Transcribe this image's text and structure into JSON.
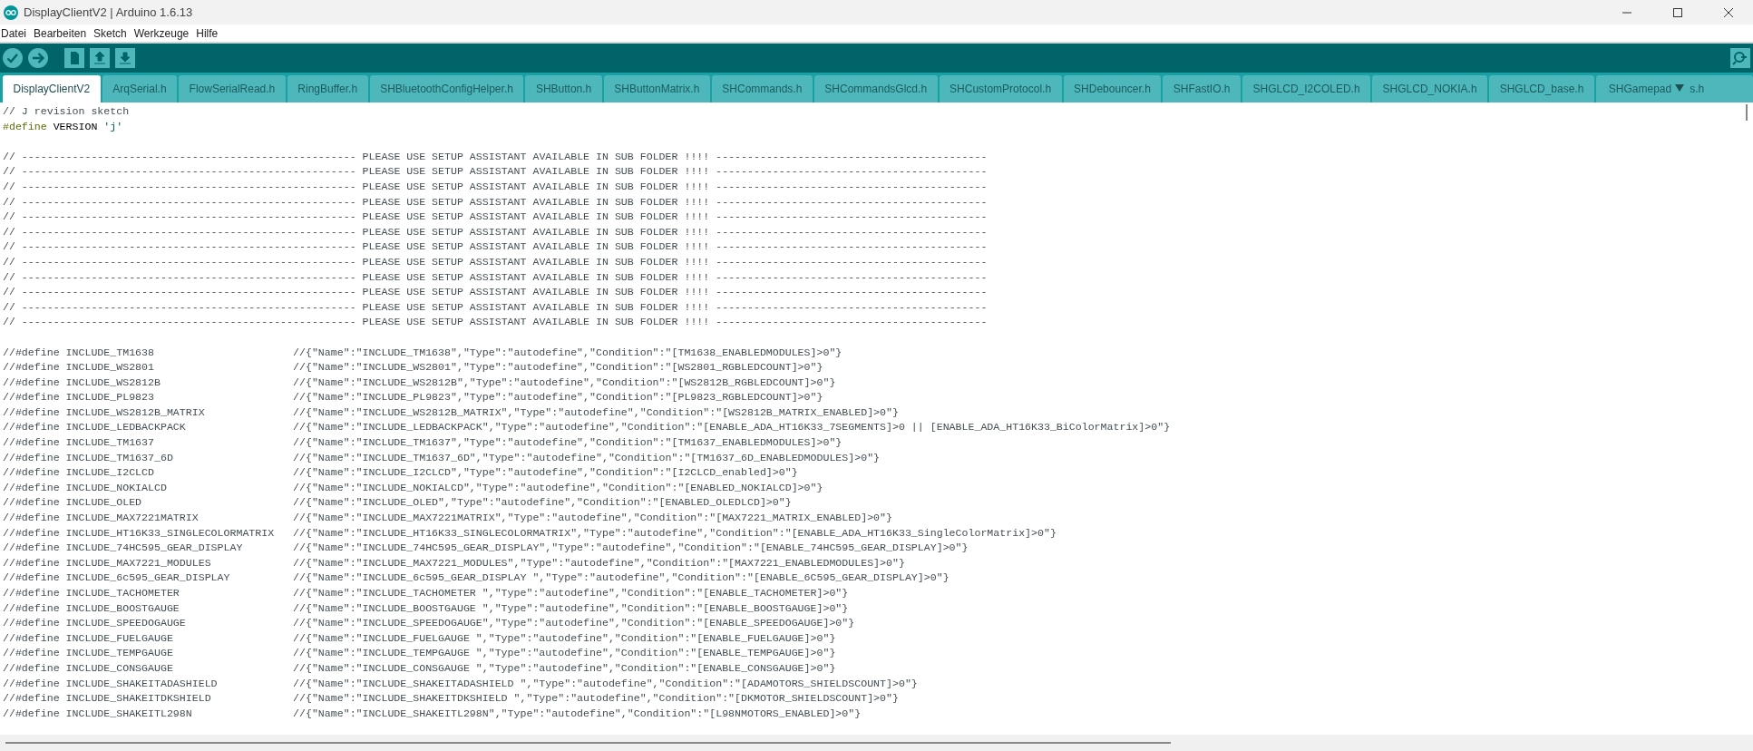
{
  "window": {
    "title": "DisplayClientV2 | Arduino 1.6.13"
  },
  "menu": [
    "Datei",
    "Bearbeiten",
    "Sketch",
    "Werkzeuge",
    "Hilfe"
  ],
  "tabs": [
    {
      "label": "DisplayClientV2",
      "selected": true
    },
    {
      "label": "ArqSerial.h",
      "selected": false
    },
    {
      "label": "FlowSerialRead.h",
      "selected": false
    },
    {
      "label": "RingBuffer.h",
      "selected": false
    },
    {
      "label": "SHBluetoothConfigHelper.h",
      "selected": false
    },
    {
      "label": "SHButton.h",
      "selected": false
    },
    {
      "label": "SHButtonMatrix.h",
      "selected": false
    },
    {
      "label": "SHCommands.h",
      "selected": false
    },
    {
      "label": "SHCommandsGlcd.h",
      "selected": false
    },
    {
      "label": "SHCustomProtocol.h",
      "selected": false
    },
    {
      "label": "SHDebouncer.h",
      "selected": false
    },
    {
      "label": "SHFastIO.h",
      "selected": false
    },
    {
      "label": "SHGLCD_I2COLED.h",
      "selected": false
    },
    {
      "label": "SHGLCD_NOKIA.h",
      "selected": false
    },
    {
      "label": "SHGLCD_base.h",
      "selected": false
    },
    {
      "label": "SHGamepad",
      "tail": "s.h",
      "selected": false
    }
  ],
  "editor": {
    "lines": [
      {
        "kind": "tokens",
        "tokens": [
          {
            "text": "// J revision sketch",
            "kind": "comment"
          }
        ]
      },
      {
        "kind": "tokens",
        "tokens": [
          {
            "text": "#define",
            "kind": "directive"
          },
          {
            "text": " VERSION ",
            "kind": "plain"
          },
          {
            "text": "'j'",
            "kind": "string"
          }
        ]
      },
      {
        "kind": "blank"
      },
      {
        "kind": "banner",
        "left": "// -----------------------------------------------------",
        "middle": "PLEASE USE SETUP ASSISTANT AVAILABLE IN SUB FOLDER !!!!",
        "right": "-------------------------------------------"
      },
      {
        "kind": "banner",
        "left": "// -----------------------------------------------------",
        "middle": "PLEASE USE SETUP ASSISTANT AVAILABLE IN SUB FOLDER !!!!",
        "right": "-------------------------------------------"
      },
      {
        "kind": "banner",
        "left": "// -----------------------------------------------------",
        "middle": "PLEASE USE SETUP ASSISTANT AVAILABLE IN SUB FOLDER !!!!",
        "right": "-------------------------------------------"
      },
      {
        "kind": "banner",
        "left": "// -----------------------------------------------------",
        "middle": "PLEASE USE SETUP ASSISTANT AVAILABLE IN SUB FOLDER !!!!",
        "right": "-------------------------------------------"
      },
      {
        "kind": "banner",
        "left": "// -----------------------------------------------------",
        "middle": "PLEASE USE SETUP ASSISTANT AVAILABLE IN SUB FOLDER !!!!",
        "right": "-------------------------------------------"
      },
      {
        "kind": "banner",
        "left": "// -----------------------------------------------------",
        "middle": "PLEASE USE SETUP ASSISTANT AVAILABLE IN SUB FOLDER !!!!",
        "right": "-------------------------------------------"
      },
      {
        "kind": "banner",
        "left": "// -----------------------------------------------------",
        "middle": "PLEASE USE SETUP ASSISTANT AVAILABLE IN SUB FOLDER !!!!",
        "right": "-------------------------------------------"
      },
      {
        "kind": "banner",
        "left": "// -----------------------------------------------------",
        "middle": "PLEASE USE SETUP ASSISTANT AVAILABLE IN SUB FOLDER !!!!",
        "right": "-------------------------------------------"
      },
      {
        "kind": "banner",
        "left": "// -----------------------------------------------------",
        "middle": "PLEASE USE SETUP ASSISTANT AVAILABLE IN SUB FOLDER !!!!",
        "right": "-------------------------------------------"
      },
      {
        "kind": "banner",
        "left": "// -----------------------------------------------------",
        "middle": "PLEASE USE SETUP ASSISTANT AVAILABLE IN SUB FOLDER !!!!",
        "right": "-------------------------------------------"
      },
      {
        "kind": "banner",
        "left": "// -----------------------------------------------------",
        "middle": "PLEASE USE SETUP ASSISTANT AVAILABLE IN SUB FOLDER !!!!",
        "right": "-------------------------------------------"
      },
      {
        "kind": "banner",
        "left": "// -----------------------------------------------------",
        "middle": "PLEASE USE SETUP ASSISTANT AVAILABLE IN SUB FOLDER !!!!",
        "right": "-------------------------------------------"
      },
      {
        "kind": "blank"
      },
      {
        "kind": "define",
        "code": "//#define INCLUDE_TM1638",
        "comment": "//{\"Name\":\"INCLUDE_TM1638\",\"Type\":\"autodefine\",\"Condition\":\"[TM1638_ENABLEDMODULES]>0\"}"
      },
      {
        "kind": "define",
        "code": "//#define INCLUDE_WS2801",
        "comment": "//{\"Name\":\"INCLUDE_WS2801\",\"Type\":\"autodefine\",\"Condition\":\"[WS2801_RGBLEDCOUNT]>0\"}"
      },
      {
        "kind": "define",
        "code": "//#define INCLUDE_WS2812B",
        "comment": "//{\"Name\":\"INCLUDE_WS2812B\",\"Type\":\"autodefine\",\"Condition\":\"[WS2812B_RGBLEDCOUNT]>0\"}"
      },
      {
        "kind": "define",
        "code": "//#define INCLUDE_PL9823",
        "comment": "//{\"Name\":\"INCLUDE_PL9823\",\"Type\":\"autodefine\",\"Condition\":\"[PL9823_RGBLEDCOUNT]>0\"}"
      },
      {
        "kind": "define",
        "code": "//#define INCLUDE_WS2812B_MATRIX",
        "comment": "//{\"Name\":\"INCLUDE_WS2812B_MATRIX\",\"Type\":\"autodefine\",\"Condition\":\"[WS2812B_MATRIX_ENABLED]>0\"}"
      },
      {
        "kind": "define",
        "code": "//#define INCLUDE_LEDBACKPACK",
        "comment": "//{\"Name\":\"INCLUDE_LEDBACKPACK\",\"Type\":\"autodefine\",\"Condition\":\"[ENABLE_ADA_HT16K33_7SEGMENTS]>0 || [ENABLE_ADA_HT16K33_BiColorMatrix]>0\"}"
      },
      {
        "kind": "define",
        "code": "//#define INCLUDE_TM1637",
        "comment": "//{\"Name\":\"INCLUDE_TM1637\",\"Type\":\"autodefine\",\"Condition\":\"[TM1637_ENABLEDMODULES]>0\"}"
      },
      {
        "kind": "define",
        "code": "//#define INCLUDE_TM1637_6D",
        "comment": "//{\"Name\":\"INCLUDE_TM1637_6D\",\"Type\":\"autodefine\",\"Condition\":\"[TM1637_6D_ENABLEDMODULES]>0\"}"
      },
      {
        "kind": "define",
        "code": "//#define INCLUDE_I2CLCD",
        "comment": "//{\"Name\":\"INCLUDE_I2CLCD\",\"Type\":\"autodefine\",\"Condition\":\"[I2CLCD_enabled]>0\"}"
      },
      {
        "kind": "define",
        "code": "//#define INCLUDE_NOKIALCD",
        "comment": "//{\"Name\":\"INCLUDE_NOKIALCD\",\"Type\":\"autodefine\",\"Condition\":\"[ENABLED_NOKIALCD]>0\"}"
      },
      {
        "kind": "define",
        "code": "//#define INCLUDE_OLED",
        "comment": "//{\"Name\":\"INCLUDE_OLED\",\"Type\":\"autodefine\",\"Condition\":\"[ENABLED_OLEDLCD]>0\"}"
      },
      {
        "kind": "define",
        "code": "//#define INCLUDE_MAX7221MATRIX",
        "comment": "//{\"Name\":\"INCLUDE_MAX7221MATRIX\",\"Type\":\"autodefine\",\"Condition\":\"[MAX7221_MATRIX_ENABLED]>0\"}"
      },
      {
        "kind": "define",
        "code": "//#define INCLUDE_HT16K33_SINGLECOLORMATRIX",
        "comment": "//{\"Name\":\"INCLUDE_HT16K33_SINGLECOLORMATRIX\",\"Type\":\"autodefine\",\"Condition\":\"[ENABLE_ADA_HT16K33_SingleColorMatrix]>0\"}"
      },
      {
        "kind": "define",
        "code": "//#define INCLUDE_74HC595_GEAR_DISPLAY",
        "comment": "//{\"Name\":\"INCLUDE_74HC595_GEAR_DISPLAY\",\"Type\":\"autodefine\",\"Condition\":\"[ENABLE_74HC595_GEAR_DISPLAY]>0\"}"
      },
      {
        "kind": "define",
        "code": "//#define INCLUDE_MAX7221_MODULES",
        "comment": "//{\"Name\":\"INCLUDE_MAX7221_MODULES\",\"Type\":\"autodefine\",\"Condition\":\"[MAX7221_ENABLEDMODULES]>0\"}"
      },
      {
        "kind": "define",
        "code": "//#define INCLUDE_6c595_GEAR_DISPLAY",
        "comment": "//{\"Name\":\"INCLUDE_6c595_GEAR_DISPLAY \",\"Type\":\"autodefine\",\"Condition\":\"[ENABLE_6C595_GEAR_DISPLAY]>0\"}"
      },
      {
        "kind": "define",
        "code": "//#define INCLUDE_TACHOMETER",
        "comment": "//{\"Name\":\"INCLUDE_TACHOMETER \",\"Type\":\"autodefine\",\"Condition\":\"[ENABLE_TACHOMETER]>0\"}"
      },
      {
        "kind": "define",
        "code": "//#define INCLUDE_BOOSTGAUGE",
        "comment": "//{\"Name\":\"INCLUDE_BOOSTGAUGE \",\"Type\":\"autodefine\",\"Condition\":\"[ENABLE_BOOSTGAUGE]>0\"}"
      },
      {
        "kind": "define",
        "code": "//#define INCLUDE_SPEEDOGAUGE",
        "comment": "//{\"Name\":\"INCLUDE_SPEEDOGAUGE\",\"Type\":\"autodefine\",\"Condition\":\"[ENABLE_SPEEDOGAUGE]>0\"}"
      },
      {
        "kind": "define",
        "code": "//#define INCLUDE_FUELGAUGE",
        "comment": "//{\"Name\":\"INCLUDE_FUELGAUGE \",\"Type\":\"autodefine\",\"Condition\":\"[ENABLE_FUELGAUGE]>0\"}"
      },
      {
        "kind": "define",
        "code": "//#define INCLUDE_TEMPGAUGE",
        "comment": "//{\"Name\":\"INCLUDE_TEMPGAUGE \",\"Type\":\"autodefine\",\"Condition\":\"[ENABLE_TEMPGAUGE]>0\"}"
      },
      {
        "kind": "define",
        "code": "//#define INCLUDE_CONSGAUGE",
        "comment": "//{\"Name\":\"INCLUDE_CONSGAUGE \",\"Type\":\"autodefine\",\"Condition\":\"[ENABLE_CONSGAUGE]>0\"}"
      },
      {
        "kind": "define",
        "code": "//#define INCLUDE_SHAKEITADASHIELD",
        "comment": "//{\"Name\":\"INCLUDE_SHAKEITADASHIELD \",\"Type\":\"autodefine\",\"Condition\":\"[ADAMOTORS_SHIELDSCOUNT]>0\"}"
      },
      {
        "kind": "define",
        "code": "//#define INCLUDE_SHAKEITDKSHIELD",
        "comment": "//{\"Name\":\"INCLUDE_SHAKEITDKSHIELD \",\"Type\":\"autodefine\",\"Condition\":\"[DKMOTOR_SHIELDSCOUNT]>0\"}"
      },
      {
        "kind": "define",
        "code": "//#define INCLUDE_SHAKEITL298N",
        "comment": "//{\"Name\":\"INCLUDE_SHAKEITL298N\",\"Type\":\"autodefine\",\"Condition\":\"[L98NMOTORS_ENABLED]>0\"}"
      }
    ]
  }
}
